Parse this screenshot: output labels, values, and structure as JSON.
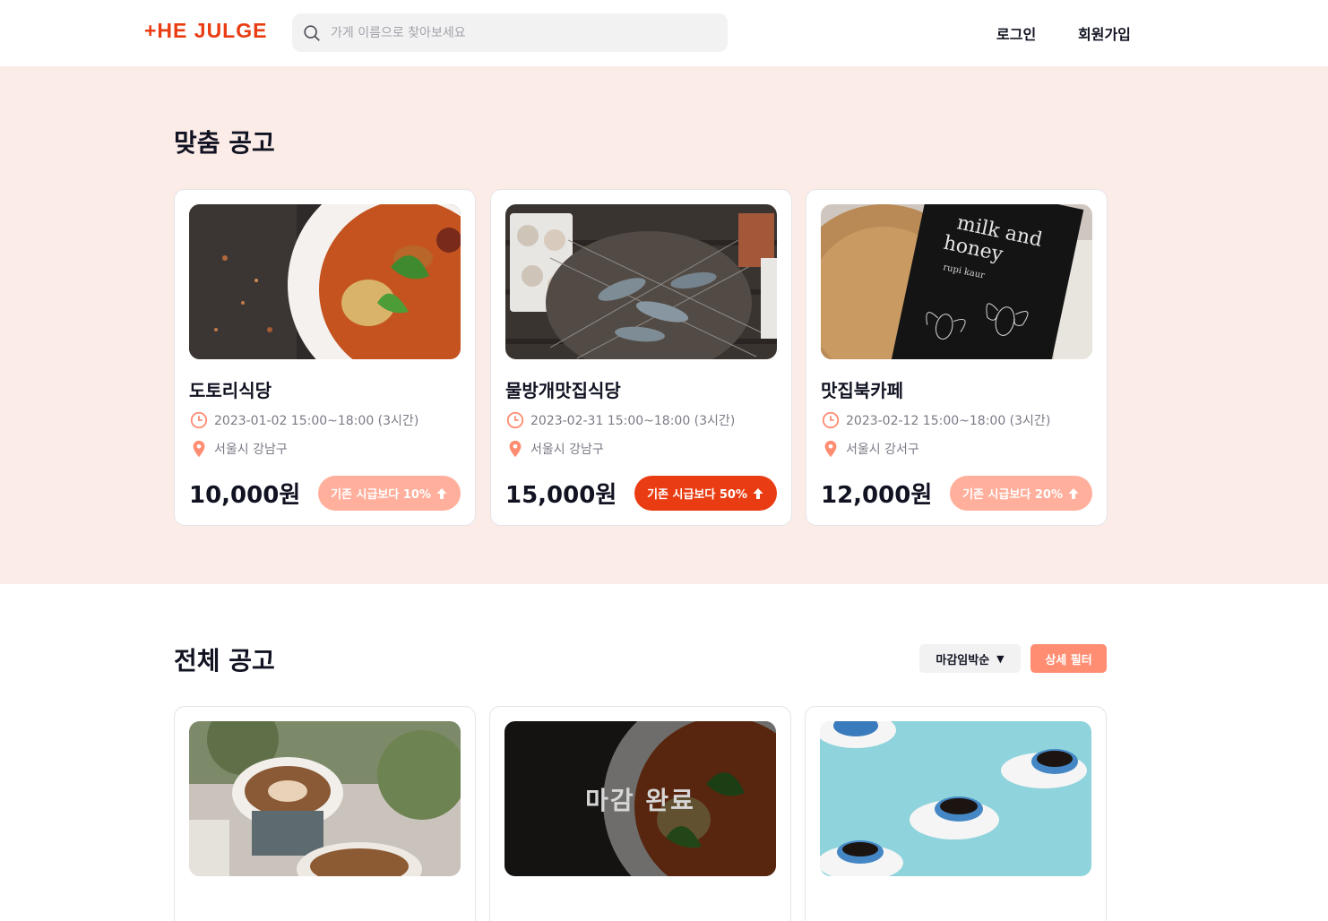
{
  "header": {
    "logo_text": "+HE JULGE",
    "search_placeholder": "가게 이름으로 찾아보세요",
    "login_label": "로그인",
    "signup_label": "회원가입"
  },
  "custom_section": {
    "title": "맞춤 공고",
    "cards": [
      {
        "name": "도토리식당",
        "datetime": "2023-01-02 15:00~18:00 (3시간)",
        "location": "서울시 강남구",
        "price": "10,000원",
        "badge": "기존 시급보다 10%",
        "badge_color": "#ffaf9b"
      },
      {
        "name": "물방개맛집식당",
        "datetime": "2023-02-31 15:00~18:00 (3시간)",
        "location": "서울시 강남구",
        "price": "15,000원",
        "badge": "기존 시급보다 50%",
        "badge_color": "#ea3c12"
      },
      {
        "name": "맛집북카페",
        "datetime": "2023-02-12 15:00~18:00 (3시간)",
        "location": "서울시 강서구",
        "price": "12,000원",
        "badge": "기존 시급보다 20%",
        "badge_color": "#ffaf9b"
      }
    ],
    "book_cover_text": {
      "line1": "milk and",
      "line2": "honey",
      "author": "rupi kaur"
    }
  },
  "all_section": {
    "title": "전체 공고",
    "sort_label": "마감임박순",
    "filter_label": "상세 필터",
    "closed_label": "마감 완료"
  },
  "colors": {
    "accent": "#ea3c12",
    "accent_light": "#ffaf9b",
    "section_bg": "#fcece8",
    "meta_icon": "#ff8d72"
  }
}
